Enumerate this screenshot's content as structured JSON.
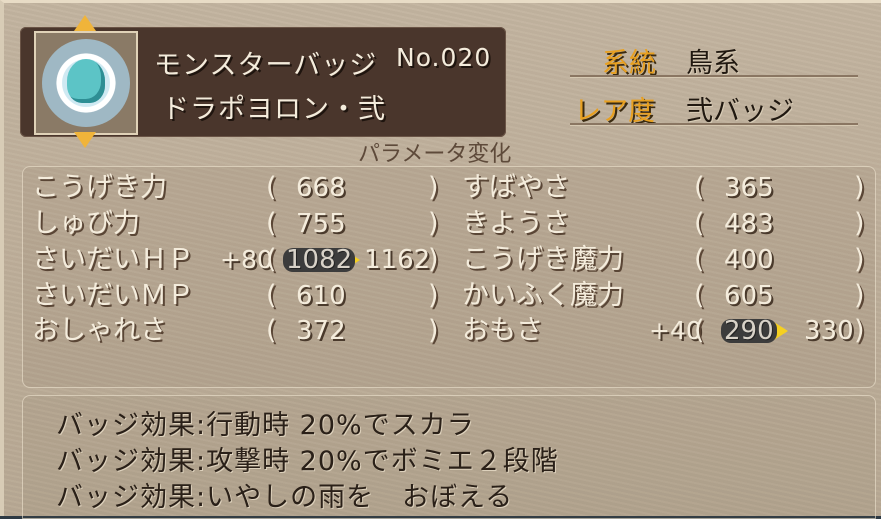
{
  "header": {
    "badge_type": "モンスターバッジ",
    "number": "No.020",
    "name": "ドラポヨロン・弐"
  },
  "meta": {
    "lineage_label": "系統",
    "lineage_value": "鳥系",
    "rarity_label": "レア度",
    "rarity_value": "弐バッジ"
  },
  "section_title": "パラメータ変化",
  "stats_left": [
    {
      "label": "こうげき力",
      "bonus": "",
      "value": "668",
      "new_value": ""
    },
    {
      "label": "しゅび力",
      "bonus": "",
      "value": "755",
      "new_value": ""
    },
    {
      "label": "さいだいＨＰ",
      "bonus": "+80",
      "value": "1082",
      "new_value": "1162"
    },
    {
      "label": "さいだいＭＰ",
      "bonus": "",
      "value": "610",
      "new_value": ""
    },
    {
      "label": "おしゃれさ",
      "bonus": "",
      "value": "372",
      "new_value": ""
    }
  ],
  "stats_right": [
    {
      "label": "すばやさ",
      "bonus": "",
      "value": "365",
      "new_value": ""
    },
    {
      "label": "きようさ",
      "bonus": "",
      "value": "483",
      "new_value": ""
    },
    {
      "label": "こうげき魔力",
      "bonus": "",
      "value": "400",
      "new_value": ""
    },
    {
      "label": "かいふく魔力",
      "bonus": "",
      "value": "605",
      "new_value": ""
    },
    {
      "label": "おもさ",
      "bonus": "+40",
      "value": "290",
      "new_value": "330"
    }
  ],
  "paren_open": "(",
  "paren_close": ")",
  "effects": [
    "バッジ効果:行動時 20%でスカラ",
    "バッジ効果:攻撃時 20%でボミエ２段階",
    "バッジ効果:いやしの雨を　おぼえる"
  ],
  "icons": {
    "portrait": "monster-portrait-icon",
    "up": "arrow-up-icon",
    "down": "arrow-down-icon",
    "change": "triangle-arrow-icon"
  },
  "colors": {
    "accent_label": "#e8a020",
    "arrow": "#f5d020",
    "header_bg": "#4a362c"
  }
}
